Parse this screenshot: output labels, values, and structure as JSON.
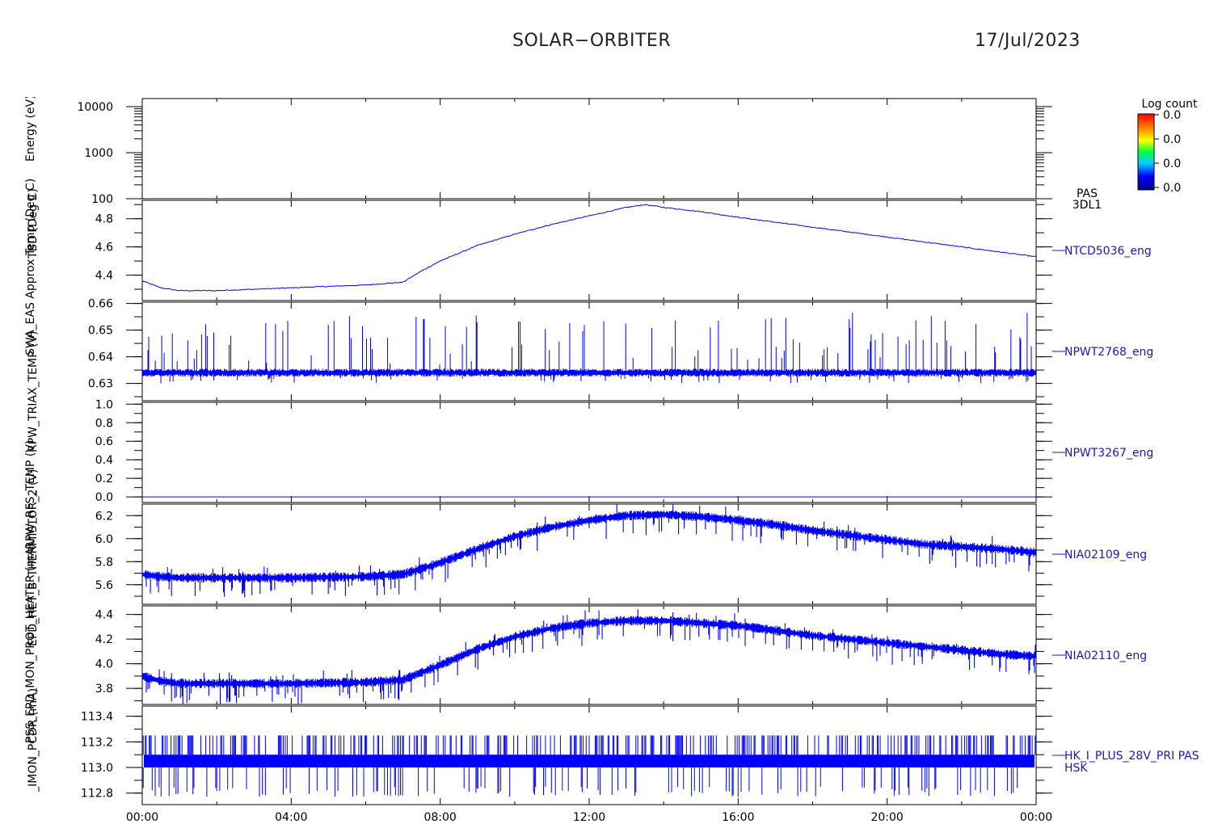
{
  "header": {
    "title": "SOLAR−ORBITER",
    "date": "17/Jul/2023"
  },
  "y_axis_labels": [
    "Energy (eV)",
    "TBD (Deg C)",
    "SWA_EAS Approx Temp (Deg C)",
    "RPW_TRIAX_TEMP (V)",
    "RPW_RFS_TEMP (V)",
    "EPD_HET_B_THERMISTOR_2 (V)",
    "PSS_EPD_MON_PROT_HEATER (mA)",
    "ADM_HK_IMON_PCDR (mA)"
  ],
  "colorbar": {
    "title": "Log count",
    "ticks": [
      "0.0",
      "0.0",
      "0.0",
      "0.0"
    ]
  },
  "chart_data": [
    {
      "type": "heatmap",
      "panel_label": [
        "PAS",
        "3DL1"
      ],
      "yscale": "log",
      "ylim": [
        100,
        15000
      ],
      "ytick_labels": [
        "10000",
        "1000",
        "100"
      ],
      "ytick_values": [
        10000,
        1000,
        100
      ],
      "values": []
    },
    {
      "type": "line",
      "series_name": "NTCD5036_eng",
      "ylim": [
        4.22,
        4.93
      ],
      "ytick_labels": [
        "4.8",
        "4.6",
        "4.4"
      ],
      "ytick_values": [
        4.8,
        4.6,
        4.4
      ],
      "series": [
        {
          "name": "NTCD5036_eng",
          "x_hours": [
            0,
            0.5,
            1,
            1.5,
            2,
            3,
            4,
            5,
            6,
            7,
            7.5,
            8,
            9,
            10,
            11,
            12,
            13,
            13.5,
            14,
            15,
            16,
            18,
            20,
            22,
            24
          ],
          "values": [
            4.36,
            4.31,
            4.29,
            4.29,
            4.29,
            4.3,
            4.31,
            4.32,
            4.33,
            4.35,
            4.43,
            4.5,
            4.61,
            4.69,
            4.76,
            4.82,
            4.88,
            4.9,
            4.88,
            4.85,
            4.81,
            4.74,
            4.67,
            4.6,
            4.53
          ]
        }
      ]
    },
    {
      "type": "line",
      "series_name": "NPWT2768_eng",
      "ylim": [
        0.6235,
        0.6605
      ],
      "ytick_labels": [
        "0.66",
        "0.65",
        "0.64",
        "0.63"
      ],
      "ytick_values": [
        0.66,
        0.65,
        0.64,
        0.63
      ],
      "series": [
        {
          "name": "NPWT2768_eng",
          "baseline": 0.634,
          "spike_max": 0.657,
          "dip_min": 0.63
        }
      ]
    },
    {
      "type": "line",
      "series_name": "NPWT3267_eng",
      "ylim": [
        -0.06,
        1.02
      ],
      "ytick_labels": [
        "1.0",
        "0.8",
        "0.6",
        "0.4",
        "0.2",
        "0.0"
      ],
      "ytick_values": [
        1.0,
        0.8,
        0.6,
        0.4,
        0.2,
        0.0
      ],
      "series": [
        {
          "name": "NPWT3267_eng",
          "x_hours": [
            0,
            24
          ],
          "values": [
            0.0,
            0.0
          ]
        }
      ]
    },
    {
      "type": "line",
      "series_name": "NIA02109_eng",
      "ylim": [
        5.43,
        6.3
      ],
      "ytick_labels": [
        "6.2",
        "6.0",
        "5.8",
        "5.6"
      ],
      "ytick_values": [
        6.2,
        6.0,
        5.8,
        5.6
      ],
      "series": [
        {
          "name": "NIA02109_eng",
          "x_hours": [
            0,
            0.5,
            1,
            2,
            4,
            6,
            7,
            8,
            9,
            10,
            11,
            12,
            13,
            14,
            15,
            16,
            17,
            18,
            19,
            20,
            21,
            22,
            23,
            24
          ],
          "values": [
            5.69,
            5.67,
            5.66,
            5.66,
            5.66,
            5.67,
            5.69,
            5.79,
            5.91,
            6.02,
            6.1,
            6.16,
            6.2,
            6.21,
            6.19,
            6.16,
            6.12,
            6.07,
            6.03,
            5.99,
            5.95,
            5.93,
            5.91,
            5.88
          ]
        }
      ]
    },
    {
      "type": "line",
      "series_name": "NIA02110_eng",
      "ylim": [
        3.67,
        4.47
      ],
      "ytick_labels": [
        "4.4",
        "4.2",
        "4.0",
        "3.8"
      ],
      "ytick_values": [
        4.4,
        4.2,
        4.0,
        3.8
      ],
      "series": [
        {
          "name": "NIA02110_eng",
          "x_hours": [
            0,
            0.5,
            1,
            2,
            4,
            6,
            7,
            8,
            9,
            10,
            11,
            12,
            13,
            14,
            15,
            16,
            17,
            18,
            19,
            20,
            21,
            22,
            23,
            24
          ],
          "values": [
            3.9,
            3.86,
            3.84,
            3.84,
            3.84,
            3.85,
            3.87,
            3.99,
            4.12,
            4.22,
            4.29,
            4.33,
            4.35,
            4.35,
            4.33,
            4.31,
            4.27,
            4.23,
            4.2,
            4.17,
            4.14,
            4.11,
            4.08,
            4.06
          ]
        }
      ]
    },
    {
      "type": "line",
      "series_name": "HK_I_PLUS_28V_PRI PAS HSK",
      "ylim": [
        112.71,
        113.48
      ],
      "ytick_labels": [
        "113.4",
        "113.2",
        "113.0",
        "112.8"
      ],
      "ytick_values": [
        113.4,
        113.2,
        113.0,
        112.8
      ],
      "series": [
        {
          "name": "HK_I_PLUS_28V_PRI PAS HSK",
          "low": 113.0,
          "high": 113.1,
          "spike_max": 113.25,
          "dip_min": 112.85
        }
      ]
    }
  ],
  "x_axis": {
    "xlim_hours": [
      0,
      24
    ],
    "tick_labels": [
      "00:00",
      "04:00",
      "08:00",
      "12:00",
      "16:00",
      "20:00",
      "00:00"
    ],
    "tick_hours": [
      0,
      4,
      8,
      12,
      16,
      20,
      24
    ]
  },
  "colors": {
    "data": "#0000ff",
    "axis": "#000000",
    "label": "#1a1ab0"
  }
}
